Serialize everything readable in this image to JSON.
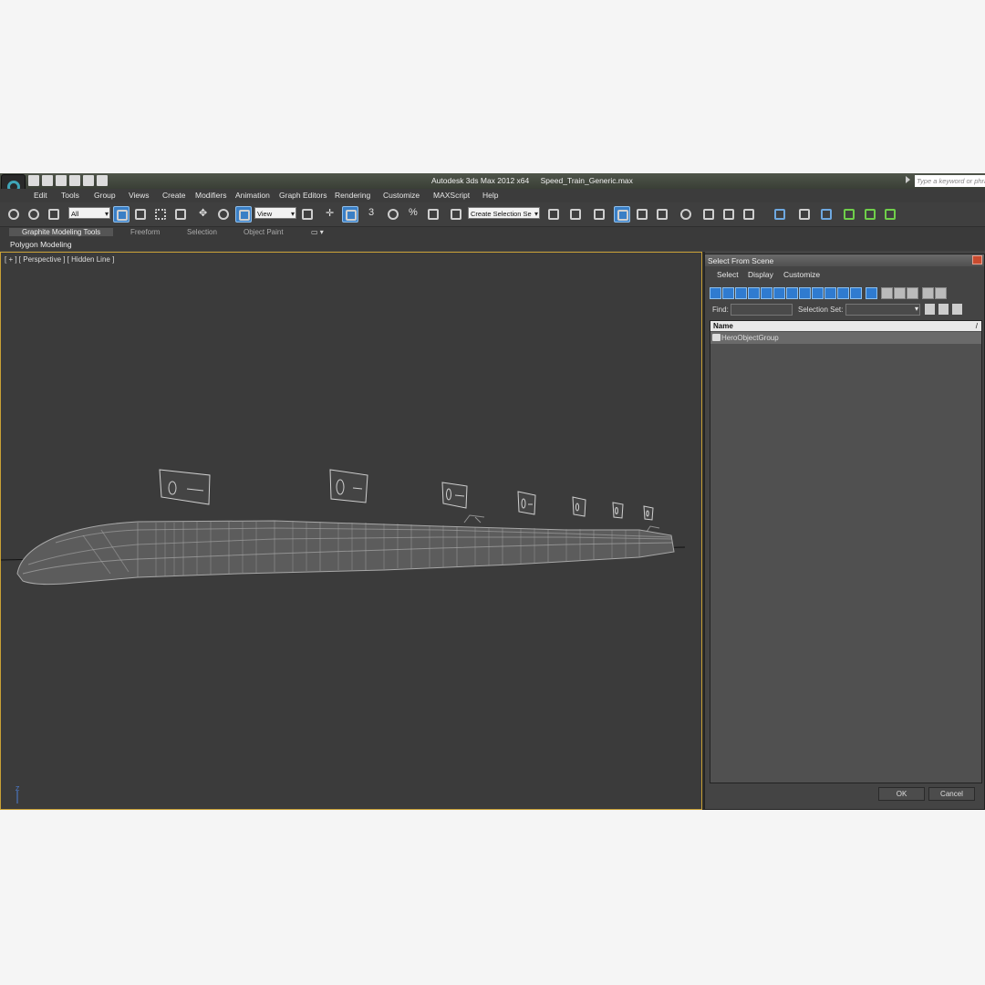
{
  "app": {
    "title": "Autodesk 3ds Max  2012 x64",
    "filename": "Speed_Train_Generic.max",
    "search_placeholder": "Type a keyword or phrase"
  },
  "menu": [
    "Edit",
    "Tools",
    "Group",
    "Views",
    "Create",
    "Modifiers",
    "Animation",
    "Graph Editors",
    "Rendering",
    "Customize",
    "MAXScript",
    "Help"
  ],
  "toolbar": {
    "filter_value": "All",
    "refcoord_value": "View",
    "selection_set_value": "Create Selection Se",
    "snap_labels": [
      "3",
      "%"
    ]
  },
  "ribbon": {
    "tabs": [
      "Graphite Modeling Tools",
      "Freeform",
      "Selection",
      "Object Paint"
    ],
    "panel": "Polygon Modeling"
  },
  "viewport": {
    "label": "[ + ] [ Perspective ] [ Hidden Line ]",
    "axis_label": "Z"
  },
  "dialog": {
    "title": "Select From Scene",
    "menu": [
      "Select",
      "Display",
      "Customize"
    ],
    "find_label": "Find:",
    "find_value": "",
    "selection_set_label": "Selection Set:",
    "selection_set_value": "",
    "column_header": "Name",
    "sort_marker": "/",
    "items": [
      "HeroObjectGroup"
    ],
    "ok_label": "OK",
    "cancel_label": "Cancel"
  },
  "colors": {
    "viewport_bg": "#3b3b3b",
    "viewport_border": "#c8a036",
    "selected_tool": "#3a7fc6",
    "wireframe": "#a8a8a8"
  }
}
